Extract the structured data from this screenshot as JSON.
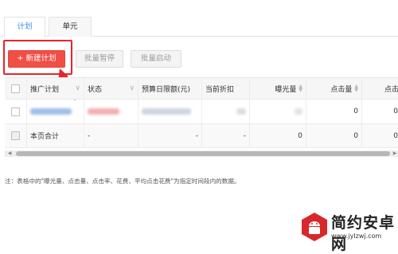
{
  "tabs": [
    {
      "label": "计划",
      "active": true
    },
    {
      "label": "单元",
      "active": false
    }
  ],
  "toolbar": {
    "new_plan": "+ 新建计划",
    "batch_pause": "批量暂停",
    "batch_start": "批量启动"
  },
  "table": {
    "headers": {
      "name": "推广计划",
      "status": "状态",
      "budget": "预算日限额(元)",
      "discount": "当前折扣",
      "impressions": "曝光量",
      "clicks": "点击量",
      "ctr": "点击率"
    },
    "subtotal_row": {
      "label": "本页合计",
      "status": "-",
      "budget": "-",
      "discount": "-",
      "impressions": "0",
      "clicks": "0",
      "ctr": "0"
    },
    "data_row": {
      "clicks": "0",
      "ctr": "0"
    }
  },
  "note": "注：表格中的\"曝光量、点击量、点击率、花费、平均点击花费\"为指定时间段内的数据。",
  "watermark": {
    "name": "简约安卓网",
    "url": "www.jylzwj.com"
  },
  "colors": {
    "primary_button": "#f04f45",
    "highlight_frame": "#e8242a",
    "active_tab_text": "#3a8ee6"
  }
}
